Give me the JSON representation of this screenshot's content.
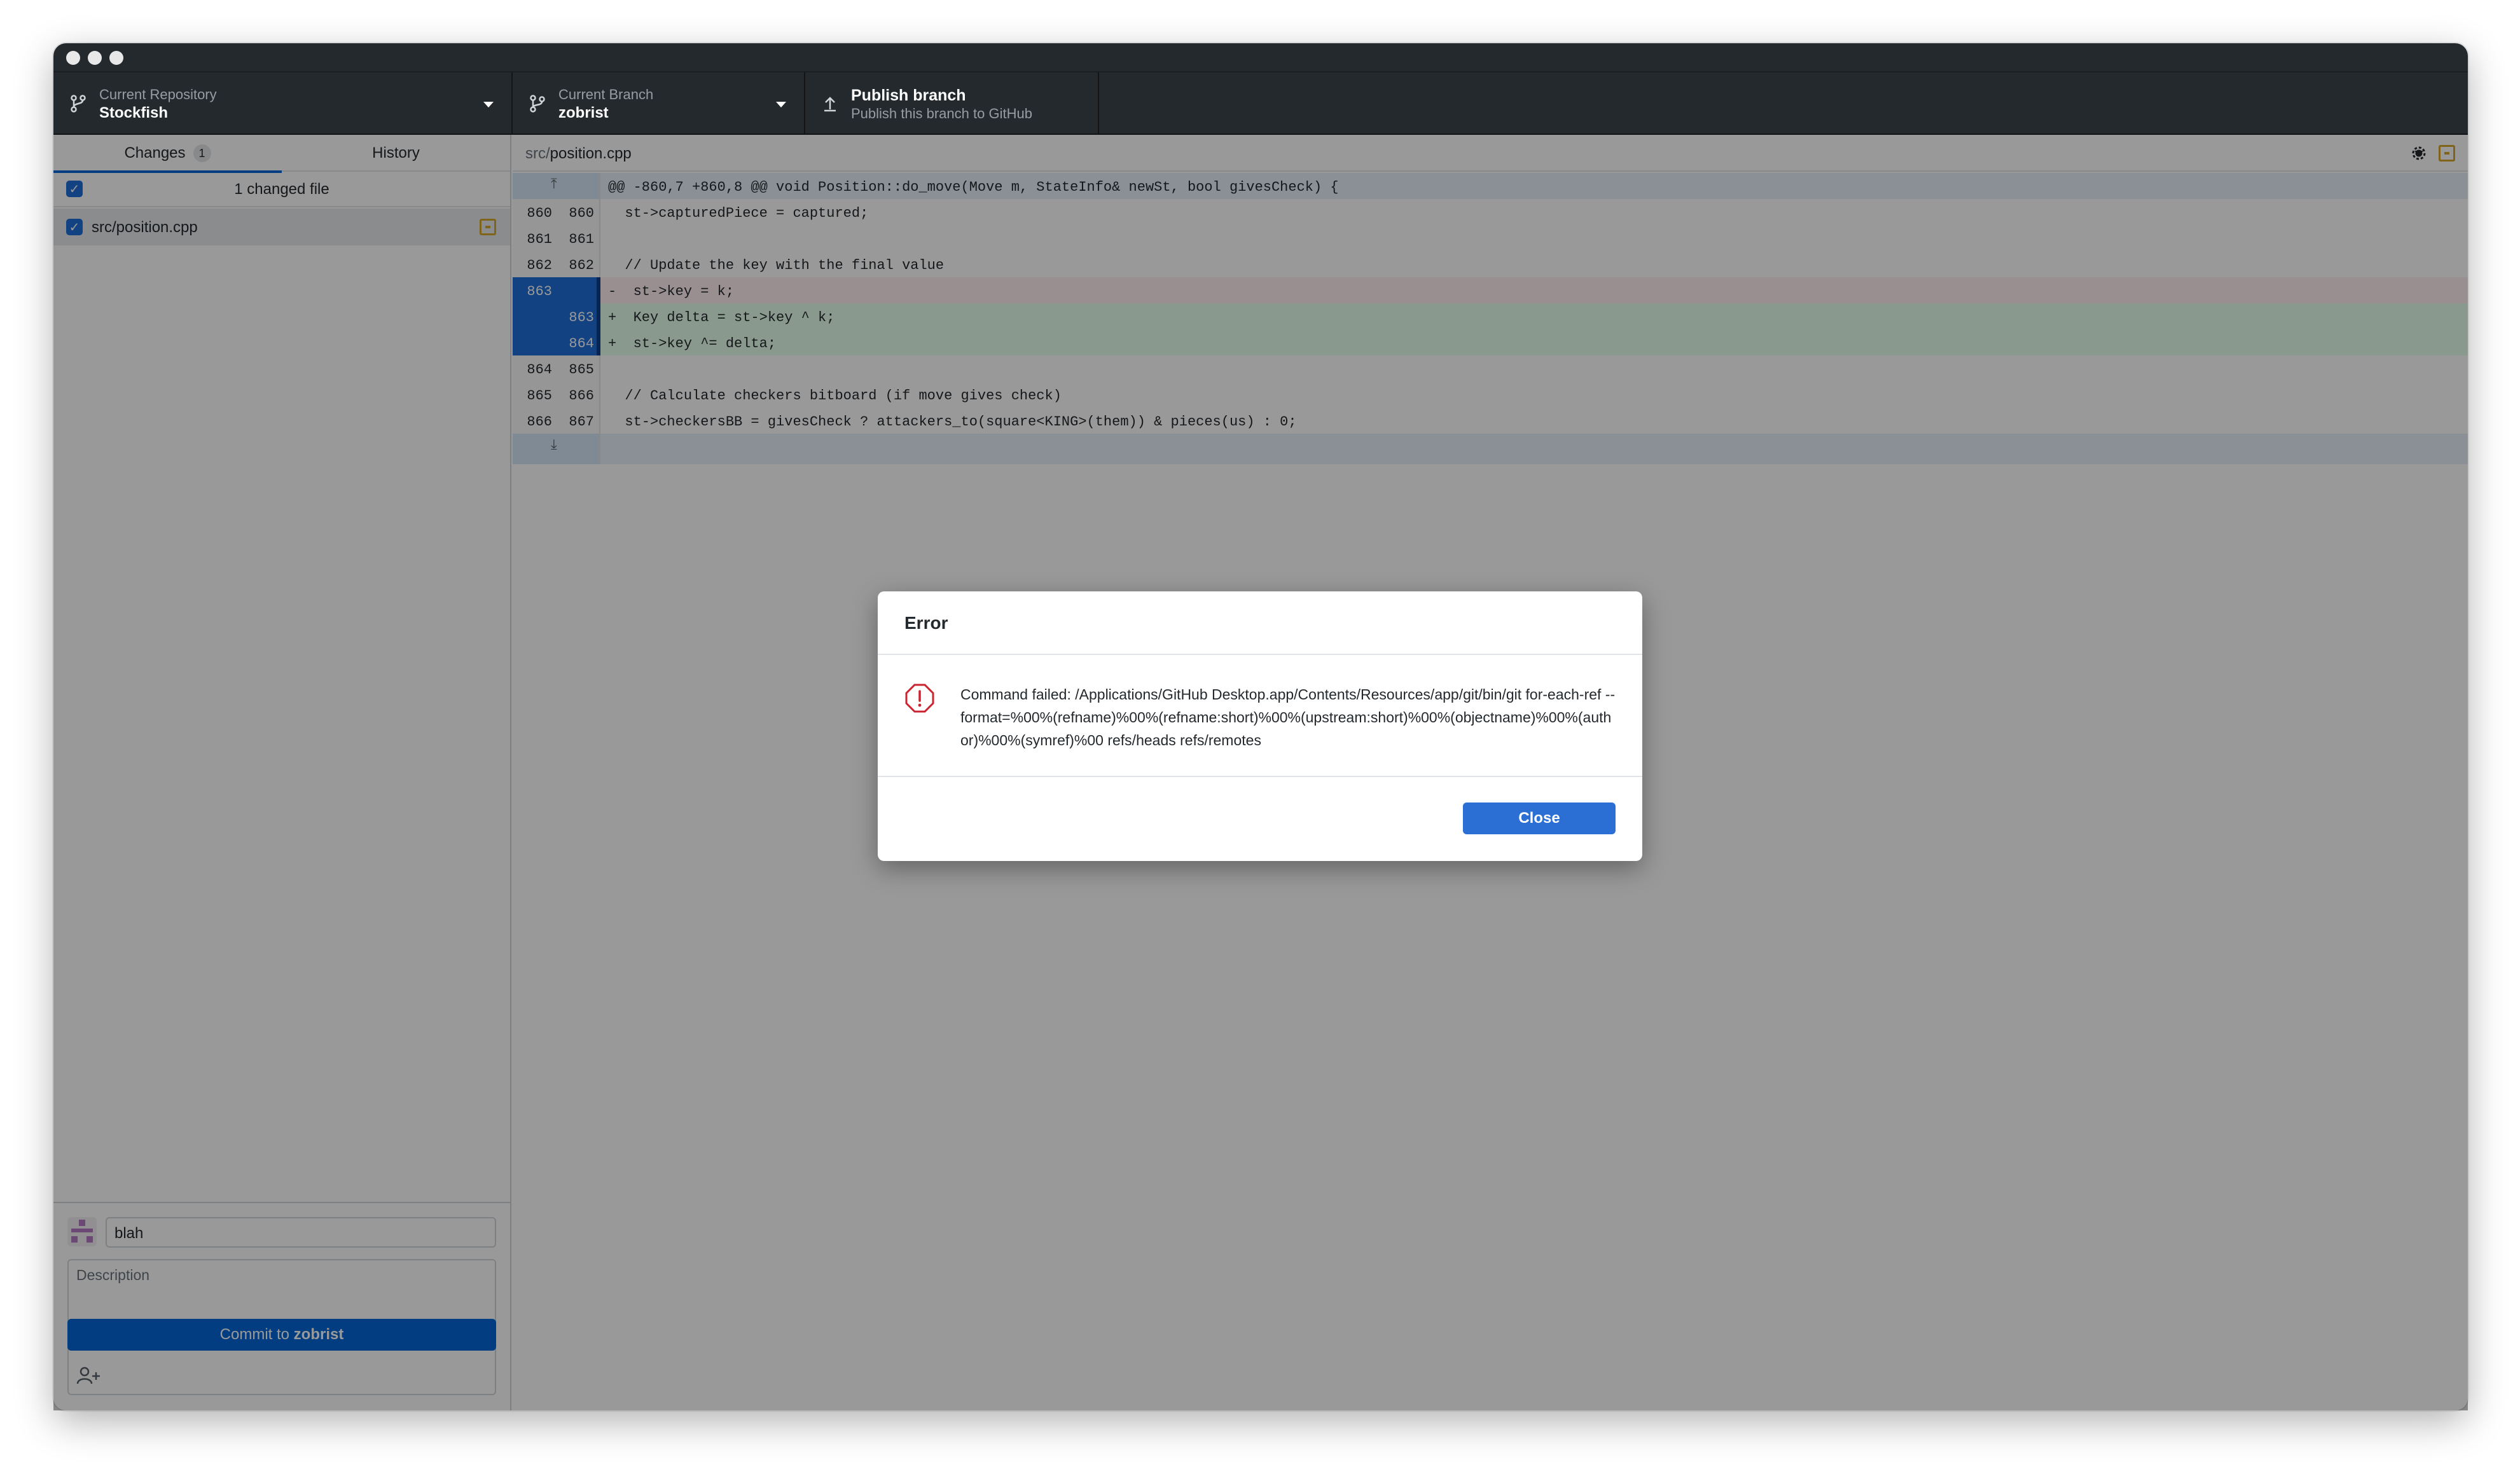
{
  "window": {
    "buttons": [
      "close",
      "minimize",
      "zoom"
    ]
  },
  "toolbar": {
    "repo": {
      "label": "Current Repository",
      "value": "Stockfish"
    },
    "branch": {
      "label": "Current Branch",
      "value": "zobrist"
    },
    "publish": {
      "title": "Publish branch",
      "subtitle": "Publish this branch to GitHub"
    }
  },
  "sidebar": {
    "tabs": [
      {
        "label": "Changes",
        "count": "1"
      },
      {
        "label": "History"
      }
    ],
    "changed_count": "1 changed file",
    "files": [
      {
        "path": "src/position.cpp",
        "status": "modified",
        "checked": true
      }
    ],
    "commit": {
      "summary": "blah",
      "description_placeholder": "Description",
      "button_prefix": "Commit to ",
      "button_branch": "zobrist"
    }
  },
  "diff": {
    "path_dir": "src/",
    "path_file": "position.cpp",
    "hunk": "@@ -860,7 +860,8 @@ void Position::do_move(Move m, StateInfo& newSt, bool givesCheck) {",
    "lines": [
      {
        "type": "context",
        "old": "860",
        "new": "860",
        "text": "  st->capturedPiece = captured;"
      },
      {
        "type": "context",
        "old": "861",
        "new": "861",
        "text": ""
      },
      {
        "type": "context",
        "old": "862",
        "new": "862",
        "text": "  // Update the key with the final value"
      },
      {
        "type": "deleted",
        "old": "863",
        "new": "",
        "text": "-  st->key = k;"
      },
      {
        "type": "added",
        "old": "",
        "new": "863",
        "text": "+  Key delta = st->key ^ k;"
      },
      {
        "type": "added",
        "old": "",
        "new": "864",
        "text": "+  st->key ^= delta;"
      },
      {
        "type": "context",
        "old": "864",
        "new": "865",
        "text": ""
      },
      {
        "type": "context",
        "old": "865",
        "new": "866",
        "text": "  // Calculate checkers bitboard (if move gives check)"
      },
      {
        "type": "context",
        "old": "866",
        "new": "867",
        "text": "  st->checkersBB = givesCheck ? attackers_to(square<KING>(them)) & pieces(us) : 0;"
      }
    ]
  },
  "dialog": {
    "title": "Error",
    "message": "Command failed: /Applications/GitHub Desktop.app/Contents/Resources/app/git/bin/git for-each-ref --format=%00%(refname)%00%(refname:short)%00%(upstream:short)%00%(objectname)%00%(author)%00%(symref)%00 refs/heads refs/remotes",
    "close_label": "Close"
  },
  "colors": {
    "toolbar_bg": "#24292e",
    "accent": "#2b6fd4",
    "error": "#cb2431",
    "modified": "#d4a72c"
  }
}
